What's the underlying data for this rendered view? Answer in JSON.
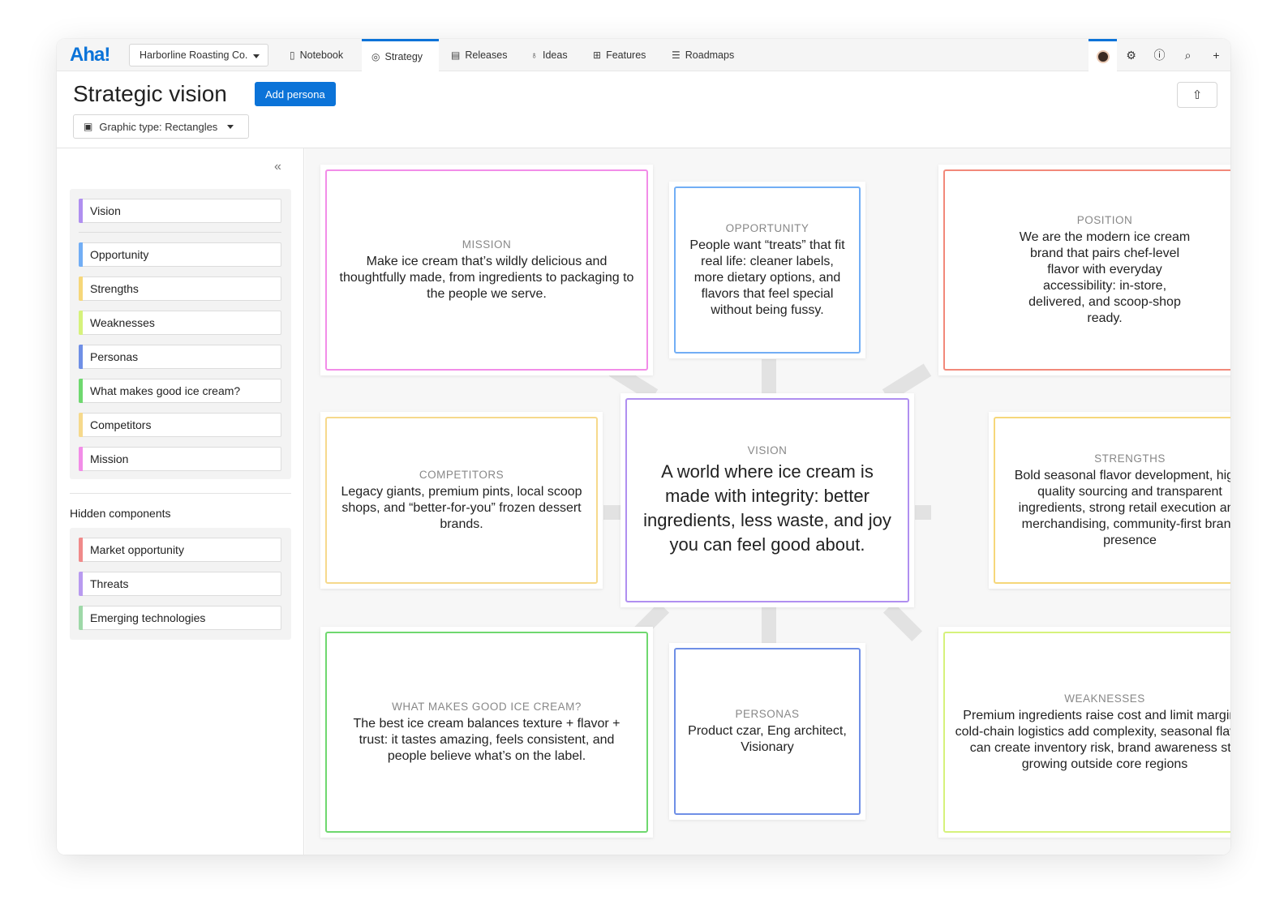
{
  "app": {
    "logo": "Aha!",
    "workspace": "Harborline Roasting Co."
  },
  "nav": {
    "tabs": [
      {
        "label": "Notebook",
        "icon": "notebook-icon"
      },
      {
        "label": "Strategy",
        "icon": "target-icon"
      },
      {
        "label": "Releases",
        "icon": "calendar-icon"
      },
      {
        "label": "Ideas",
        "icon": "lightbulb-icon"
      },
      {
        "label": "Features",
        "icon": "grid-icon"
      },
      {
        "label": "Roadmaps",
        "icon": "roadmap-icon"
      }
    ],
    "active_tab": "Strategy",
    "right_icons": [
      "avatar",
      "gear-icon",
      "help-icon",
      "search-icon",
      "plus-icon"
    ]
  },
  "header": {
    "title": "Strategic vision",
    "add_persona": "Add persona",
    "graphic_type": "Graphic type: Rectangles"
  },
  "sidebar": {
    "components": [
      {
        "label": "Vision",
        "color": "#b08ff0"
      },
      {
        "label": "Opportunity",
        "color": "#72aef5"
      },
      {
        "label": "Strengths",
        "color": "#f6d77a"
      },
      {
        "label": "Weaknesses",
        "color": "#d6f27c"
      },
      {
        "label": "Personas",
        "color": "#6f8fe6"
      },
      {
        "label": "What makes good ice cream?",
        "color": "#6fd86f"
      },
      {
        "label": "Competitors",
        "color": "#f6d98c"
      },
      {
        "label": "Mission",
        "color": "#f28de8"
      }
    ],
    "hidden_title": "Hidden components",
    "hidden": [
      {
        "label": "Market opportunity",
        "color": "#f08a8a"
      },
      {
        "label": "Threats",
        "color": "#b89af0"
      },
      {
        "label": "Emerging technologies",
        "color": "#9ed8a8"
      }
    ]
  },
  "cards": {
    "mission": {
      "label": "MISSION",
      "text": "Make ice cream that’s wildly delicious and thoughtfully made, from ingredients to packaging to the people we serve.",
      "color": "#f28de8"
    },
    "opportunity": {
      "label": "OPPORTUNITY",
      "text": "People want “treats” that fit real life: cleaner labels, more dietary options, and flavors that feel special without being fussy.",
      "color": "#72aef5"
    },
    "position": {
      "label": "POSITION",
      "text": "We are the modern ice cream brand that pairs chef-level flavor with everyday accessibility: in-store, delivered, and scoop-shop ready.",
      "color": "#f2897a"
    },
    "competitors": {
      "label": "COMPETITORS",
      "text": "Legacy giants, premium pints, local scoop shops, and “better-for-you” frozen dessert brands.",
      "color": "#f6d98c"
    },
    "vision": {
      "label": "VISION",
      "text": "A world where ice cream is made with integrity: better ingredients, less waste, and joy you can feel good about.",
      "color": "#b08ff0"
    },
    "strengths": {
      "label": "STRENGTHS",
      "text": "Bold seasonal flavor development, high-quality sourcing and transparent ingredients, strong retail execution and merchandising, community-first brand presence",
      "color": "#f6d77a"
    },
    "good_ice_cream": {
      "label": "WHAT MAKES GOOD ICE CREAM?",
      "text": "The best ice cream balances texture + flavor + trust: it tastes amazing, feels consistent, and people believe what’s on the label.",
      "color": "#6fd86f"
    },
    "personas": {
      "label": "PERSONAS",
      "text": "Product czar, Eng architect, Visionary",
      "color": "#6f8fe6"
    },
    "weaknesses": {
      "label": "WEAKNESSES",
      "text": "Premium ingredients raise cost and limit margins, cold-chain logistics add complexity, seasonal flavors can create inventory risk, brand awareness still growing outside core regions",
      "color": "#d6f27c"
    }
  }
}
